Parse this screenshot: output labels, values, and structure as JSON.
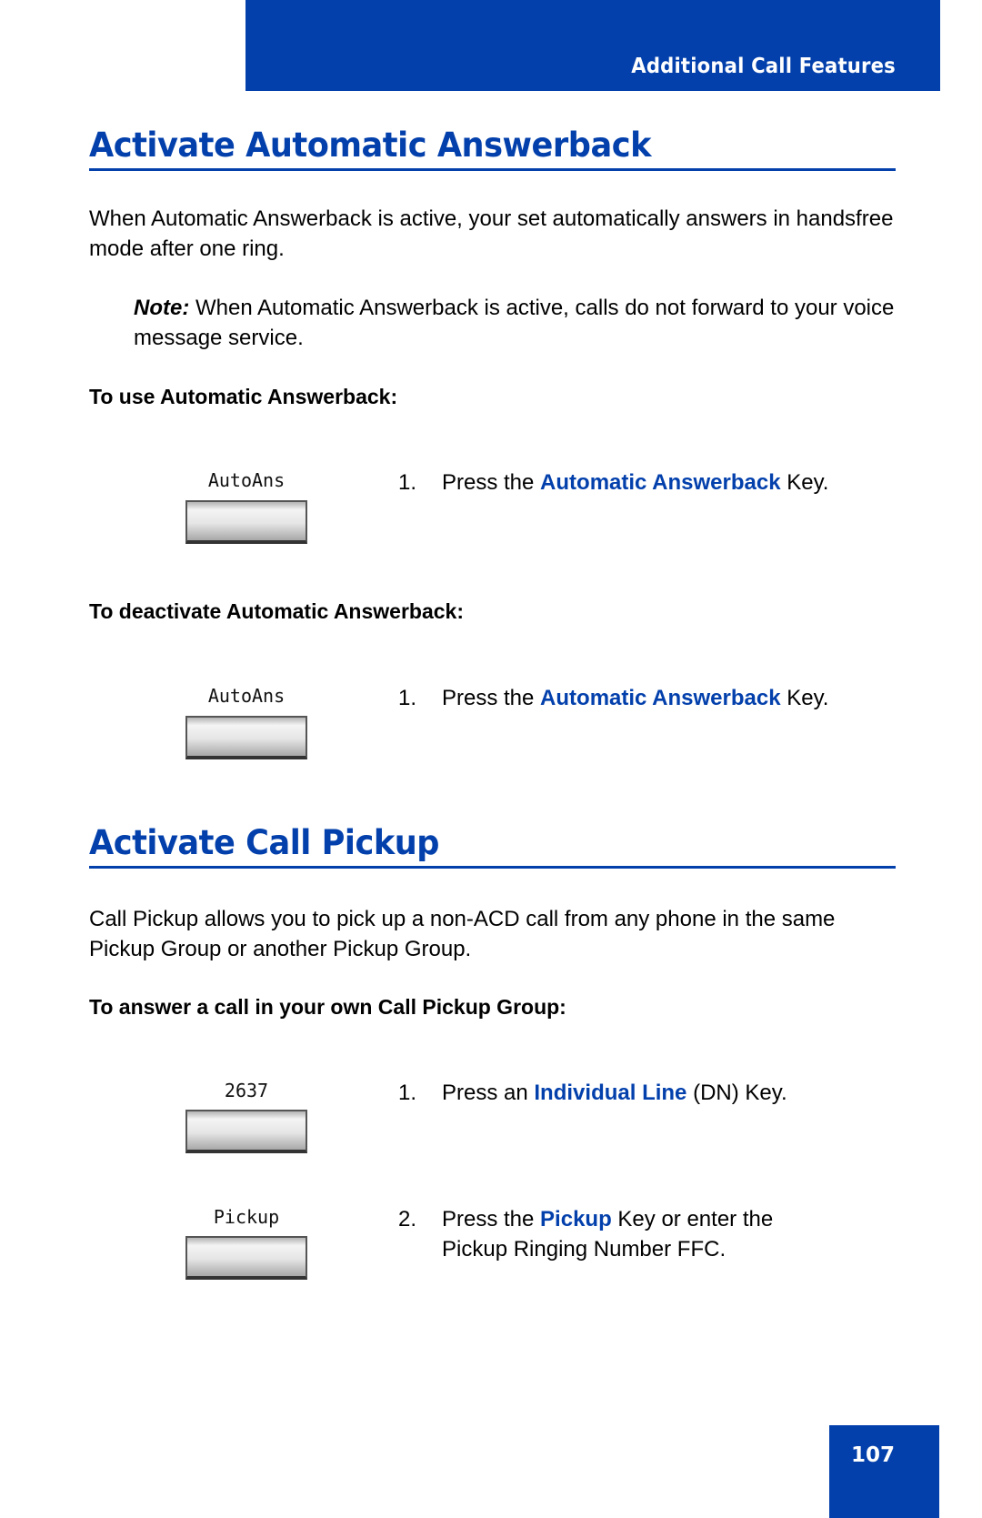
{
  "header": {
    "title": "Additional Call Features"
  },
  "section1": {
    "title": "Activate Automatic Answerback",
    "intro": "When Automatic Answerback is active, your set automatically answers in handsfree mode after one ring.",
    "note_label": "Note:",
    "note_text": " When Automatic Answerback is active, calls do not forward to your voice message service.",
    "use": {
      "heading": "To use Automatic Answerback:",
      "key_label": "AutoAns",
      "step": {
        "num": "1.",
        "pre": "Press the ",
        "highlight": "Automatic Answerback",
        "post": " Key."
      }
    },
    "deactivate": {
      "heading": "To deactivate Automatic Answerback:",
      "key_label": "AutoAns",
      "step": {
        "num": "1.",
        "pre": "Press the ",
        "highlight": "Automatic Answerback",
        "post": " Key."
      }
    }
  },
  "section2": {
    "title": "Activate Call Pickup",
    "intro": "Call Pickup allows you to pick up a non-ACD call from any phone in the same Pickup Group or another Pickup Group.",
    "own_group": {
      "heading": "To answer a call in your own Call Pickup Group:",
      "steps": [
        {
          "key_label": "2637",
          "num": "1.",
          "pre": "Press an ",
          "highlight": "Individual Line",
          "post": " (DN) Key."
        },
        {
          "key_label": "Pickup",
          "num": "2.",
          "pre": "Press the ",
          "highlight": "Pickup",
          "post": " Key or enter the Pickup Ringing Number FFC."
        }
      ]
    }
  },
  "footer": {
    "page_number": "107"
  },
  "colors": {
    "brand_blue": "#0340AC"
  }
}
